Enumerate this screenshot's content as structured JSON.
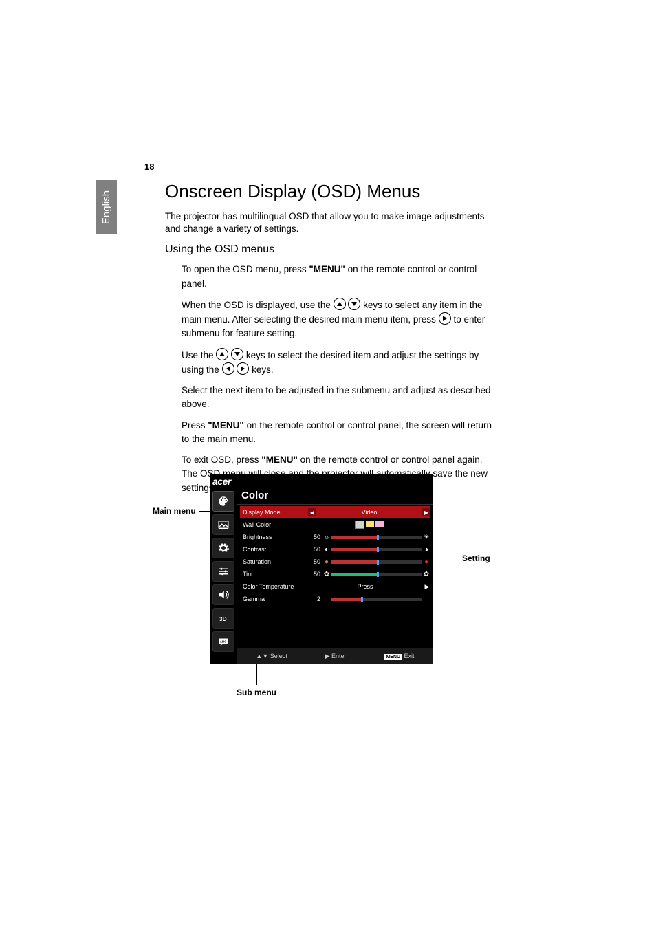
{
  "page_number": "18",
  "language_tab": "English",
  "heading": "Onscreen Display (OSD) Menus",
  "intro": "The projector has multilingual OSD that allow you to make image adjustments and change a variety of settings.",
  "subheading": "Using the OSD menus",
  "steps": {
    "s1_a": "To open the OSD menu, press ",
    "s1_menu": "\"MENU\"",
    "s1_b": " on the remote control or control panel.",
    "s2_a": "When the OSD is displayed, use the ",
    "s2_b": " keys to select any item in the main menu. After selecting the desired main menu item, press ",
    "s2_c": " to enter submenu for feature setting.",
    "s3_a": "Use the ",
    "s3_b": " keys to select the desired item and adjust the settings by using the ",
    "s3_c": " keys.",
    "s4": "Select the next item to be adjusted in the submenu and adjust as described above.",
    "s5_a": "Press ",
    "s5_menu": "\"MENU\"",
    "s5_b": " on the remote control or control panel, the screen will return to the main menu.",
    "s6_a": "To exit OSD, press ",
    "s6_menu": "\"MENU\"",
    "s6_b": " on the remote control or control panel again. The OSD menu will close and the projector will automatically save the new settings."
  },
  "osd": {
    "brand": "acer",
    "menu_title": "Color",
    "selected_row": "Display Mode",
    "display_mode_value": "Video",
    "rows": {
      "wall_color": "Wall Color",
      "brightness": "Brightness",
      "contrast": "Contrast",
      "saturation": "Saturation",
      "tint": "Tint",
      "color_temp": "Color Temperature",
      "gamma": "Gamma"
    },
    "values": {
      "brightness": "50",
      "contrast": "50",
      "saturation": "50",
      "tint": "50",
      "gamma": "2"
    },
    "color_temp_value": "Press",
    "hints": {
      "select": "Select",
      "enter": "Enter",
      "menu": "MENU",
      "exit": "Exit"
    },
    "wall_swatches": [
      "#8fd18f",
      "#f7e07a",
      "#f4b6d6",
      "#7fb2e6"
    ]
  },
  "callouts": {
    "main_menu": "Main menu",
    "setting": "Setting",
    "sub_menu": "Sub menu"
  }
}
